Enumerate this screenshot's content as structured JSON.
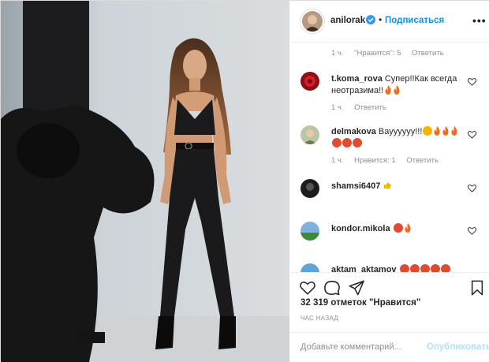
{
  "header": {
    "username": "anilorak",
    "dot": "•",
    "subscribe_label": "Подписаться",
    "more_label": "•••"
  },
  "comments": {
    "top_meta": {
      "time": "1 ч.",
      "likes": "\"Нравится\": 5",
      "reply": "Ответить"
    },
    "items": [
      {
        "user": "t.koma_rova",
        "text": "Супер!!Как всегда неотразима!!",
        "time": "1 ч.",
        "reply": "Ответить"
      },
      {
        "user": "delmakova",
        "text": "Вауууууу!!!",
        "time": "1 ч.",
        "likes": "Нравится: 1",
        "reply": "Ответить"
      },
      {
        "user": "shamsi6407",
        "text": ""
      },
      {
        "user": "kondor.mikola",
        "text": ""
      },
      {
        "user": "aktam_aktamov",
        "text": ""
      }
    ]
  },
  "likes": {
    "count_text": "32 319 отметок \"Нравится\""
  },
  "timestamp": "ЧАС НАЗАД",
  "composer": {
    "placeholder": "Добавьте комментарий...",
    "publish_label": "Опубликовать"
  },
  "colors": {
    "accent": "#0095f6",
    "accent_disabled": "#b2dffc",
    "muted": "#8e8e8e",
    "verified": "#3897f0"
  },
  "icons": [
    "verified-badge-icon",
    "more-icon",
    "heart-icon",
    "comment-icon",
    "share-icon",
    "bookmark-icon",
    "fire-emoji-icon"
  ]
}
